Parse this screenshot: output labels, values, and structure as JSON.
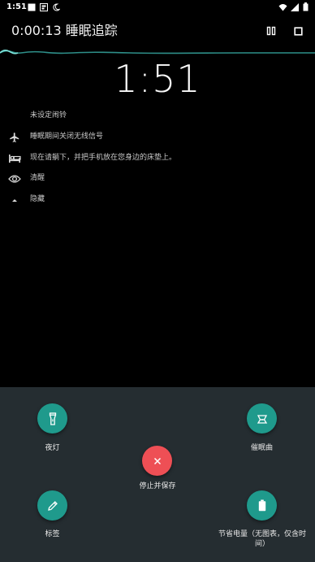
{
  "status_bar": {
    "time": "1:51",
    "icons_left": [
      "square-notification-icon",
      "card-notification-icon",
      "moon-icon"
    ],
    "icons_right": [
      "wifi-icon",
      "signal-icon",
      "battery-icon"
    ]
  },
  "toolbar": {
    "title": "0:00:13 睡眠追踪",
    "pause_icon": "pause-icon",
    "stop_icon": "stop-icon"
  },
  "clock": "1:51",
  "info": [
    {
      "icon": "",
      "text": "未设定闹铃"
    },
    {
      "icon": "airplane-icon",
      "text": "睡眠期间关闭无线信号"
    },
    {
      "icon": "bed-icon",
      "text": "现在请躺下，并把手机放在您身边的床垫上。"
    },
    {
      "icon": "eye-icon",
      "text": "清醒"
    },
    {
      "icon": "caret-up-icon",
      "text": "隐藏"
    }
  ],
  "actions": {
    "flashlight": {
      "label": "夜灯",
      "icon": "flashlight-icon"
    },
    "lullaby": {
      "label": "催眠曲",
      "icon": "lullaby-icon"
    },
    "stop_save": {
      "label": "停止并保存",
      "icon": "close-icon"
    },
    "tag": {
      "label": "标签",
      "icon": "pencil-icon"
    },
    "battery_saver": {
      "label": "节省电量（无图表，仅含时间）",
      "icon": "battery-saver-icon"
    }
  },
  "colors": {
    "background": "#000000",
    "sheet": "#252d31",
    "teal": "#1f9a8c",
    "red": "#ee4f55",
    "graph": "#3fb7b0"
  }
}
